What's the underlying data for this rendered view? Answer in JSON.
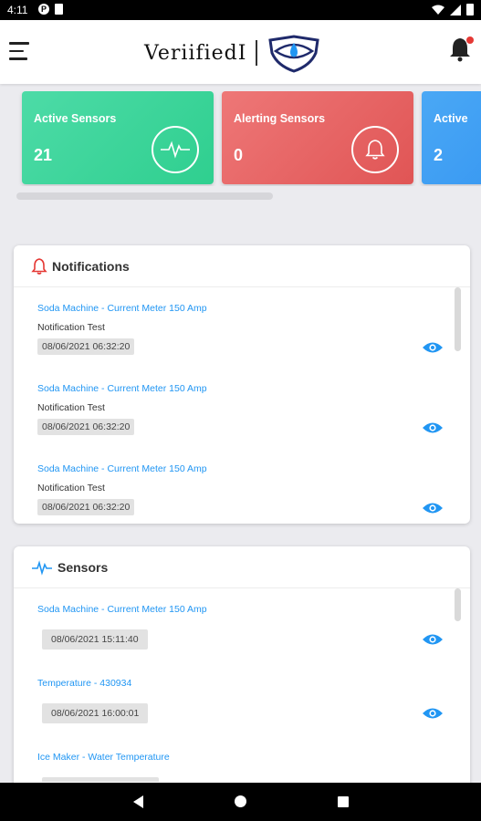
{
  "status_bar": {
    "time": "4:11"
  },
  "app": {
    "logo_text": "VeriifiedI"
  },
  "summary_cards": [
    {
      "title": "Active Sensors",
      "value": "21",
      "icon": "pulse-icon",
      "color": "#3dd39b"
    },
    {
      "title": "Alerting Sensors",
      "value": "0",
      "icon": "bell-icon",
      "color": "#e86464"
    },
    {
      "title": "Active",
      "value": "2",
      "icon": "",
      "color": "#3b9cf3"
    }
  ],
  "notifications": {
    "title": "Notifications",
    "items": [
      {
        "title": "Soda Machine - Current Meter 150 Amp",
        "message": "Notification Test",
        "date": "08/06/2021 06:32:20"
      },
      {
        "title": "Soda Machine - Current Meter 150 Amp",
        "message": "Notification Test",
        "date": "08/06/2021 06:32:20"
      },
      {
        "title": "Soda Machine - Current Meter 150 Amp",
        "message": "Notification Test",
        "date": "08/06/2021 06:32:20"
      }
    ]
  },
  "sensors": {
    "title": "Sensors",
    "items": [
      {
        "title": "Soda Machine - Current Meter 150 Amp",
        "date": "08/06/2021 15:11:40"
      },
      {
        "title": "Temperature - 430934",
        "date": "08/06/2021 16:00:01"
      },
      {
        "title": "Ice Maker - Water Temperature",
        "date": ""
      }
    ]
  },
  "colors": {
    "accent_blue": "#2196f3",
    "alert_red": "#e53935"
  }
}
